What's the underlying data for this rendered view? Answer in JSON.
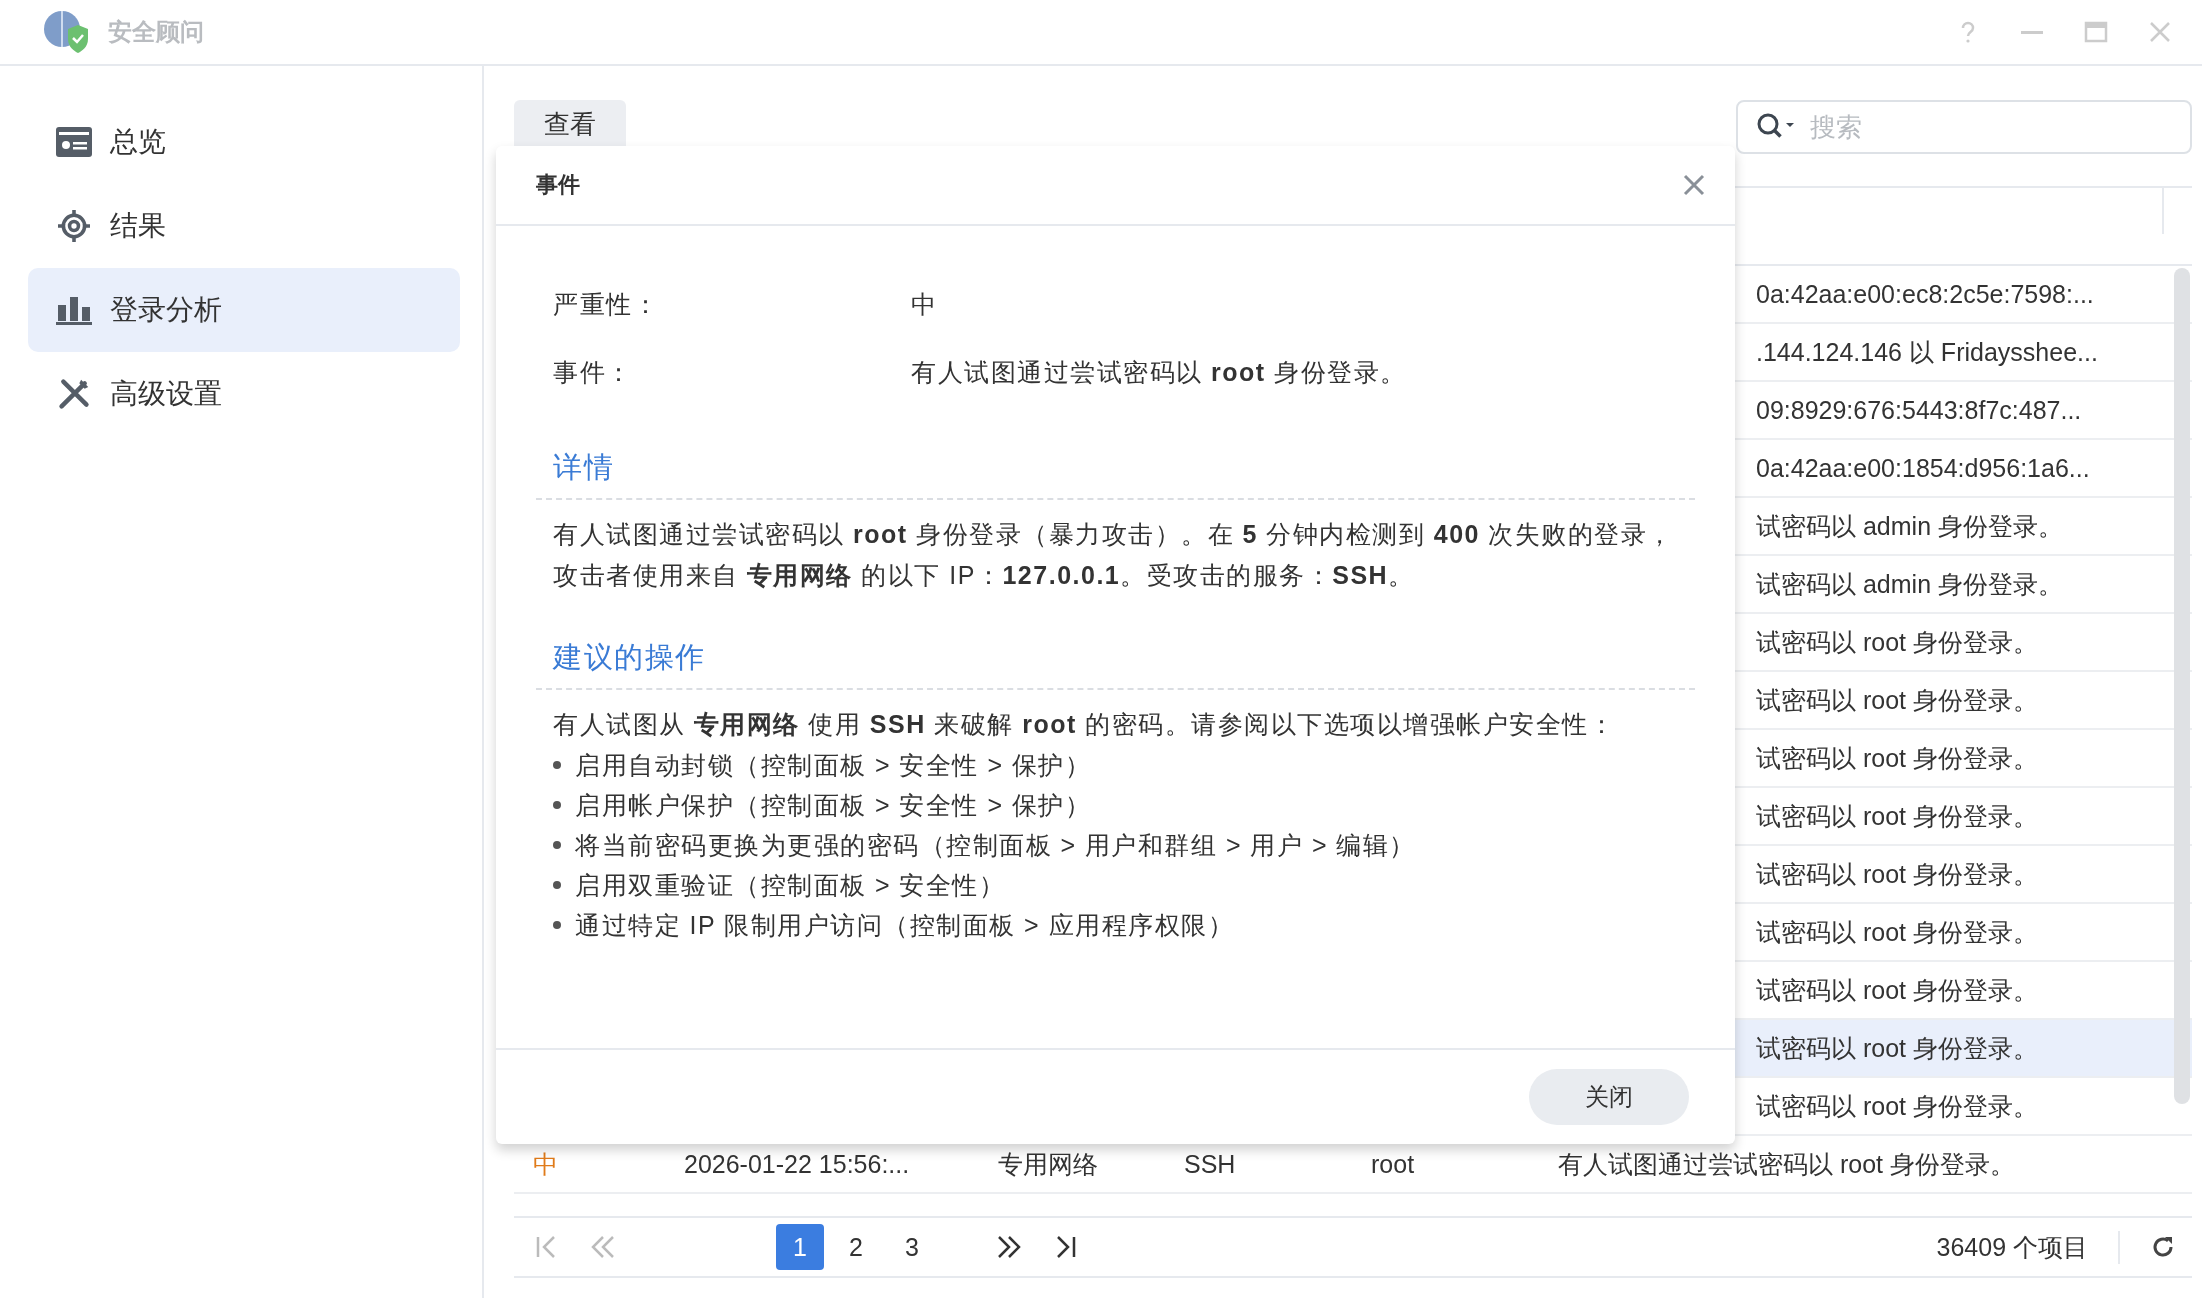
{
  "window": {
    "title": "安全顾问"
  },
  "sidebar": {
    "items": [
      {
        "label": "总览",
        "kind": "overview",
        "selected": false
      },
      {
        "label": "结果",
        "kind": "results",
        "selected": false
      },
      {
        "label": "登录分析",
        "kind": "analysis",
        "selected": true
      },
      {
        "label": "高级设置",
        "kind": "settings",
        "selected": false
      }
    ]
  },
  "toolbar": {
    "buttons": [
      "查看"
    ],
    "search": {
      "placeholder": "搜索"
    }
  },
  "table": {
    "rows": [
      {
        "kind": "covered",
        "message": "0a:42aa:e00:ec8:2c5e:7598:...",
        "selected": false
      },
      {
        "kind": "covered",
        "message": ".144.124.146 以 Fridaysshee...",
        "selected": false
      },
      {
        "kind": "covered",
        "message": "09:8929:676:5443:8f7c:487...",
        "selected": false
      },
      {
        "kind": "covered",
        "message": "0a:42aa:e00:1854:d956:1a6...",
        "selected": false
      },
      {
        "kind": "covered",
        "message": "试密码以 admin 身份登录。",
        "selected": false
      },
      {
        "kind": "covered",
        "message": "试密码以 admin 身份登录。",
        "selected": false
      },
      {
        "kind": "covered",
        "message": "试密码以 root 身份登录。",
        "selected": false
      },
      {
        "kind": "covered",
        "message": "试密码以 root 身份登录。",
        "selected": false
      },
      {
        "kind": "covered",
        "message": "试密码以 root 身份登录。",
        "selected": false
      },
      {
        "kind": "covered",
        "message": "试密码以 root 身份登录。",
        "selected": false
      },
      {
        "kind": "covered",
        "message": "试密码以 root 身份登录。",
        "selected": false
      },
      {
        "kind": "covered",
        "message": "试密码以 root 身份登录。",
        "selected": false
      },
      {
        "kind": "covered",
        "message": "试密码以 root 身份登录。",
        "selected": false
      },
      {
        "kind": "covered",
        "message": "试密码以 root 身份登录。",
        "selected": true
      },
      {
        "kind": "covered",
        "message": "试密码以 root 身份登录。",
        "selected": false
      },
      {
        "kind": "full",
        "severity": "中",
        "time": "2026-01-22 15:56:...",
        "network": "专用网络",
        "service": "SSH",
        "user": "root",
        "message": "有人试图通过尝试密码以 root 身份登录。",
        "selected": false
      }
    ]
  },
  "pagination": {
    "pages": [
      {
        "label": "1",
        "selected": true
      },
      {
        "label": "2",
        "selected": false
      },
      {
        "label": "3",
        "selected": false
      }
    ],
    "total": "36409 个项目"
  },
  "dialog": {
    "title": "事件",
    "fields": [
      {
        "label": "严重性：",
        "value": "中"
      },
      {
        "label": "事件：",
        "value": "有人试图通过尝试密码以 **root** 身份登录。"
      }
    ],
    "sections": [
      {
        "heading": "详情",
        "paragraph": "有人试图通过尝试密码以 **root** 身份登录（暴力攻击）。在 **5** 分钟内检测到 **400** 次失败的登录，攻击者使用来自 **专用网络** 的以下 IP：**127.0.0.1**。受攻击的服务：**SSH**。"
      },
      {
        "heading": "建议的操作",
        "paragraph": "有人试图从 **专用网络** 使用 **SSH** 来破解 **root** 的密码。请参阅以下选项以增强帐户安全性：",
        "bullets": [
          "启用自动封锁（控制面板 > 安全性 > 保护）",
          "启用帐户保护（控制面板 > 安全性 > 保护）",
          "将当前密码更换为更强的密码（控制面板 > 用户和群组 > 用户 > 编辑）",
          "启用双重验证（控制面板 > 安全性）",
          "通过特定 IP 限制用户访问（控制面板 > 应用程序权限）"
        ]
      }
    ],
    "button": "关闭"
  }
}
